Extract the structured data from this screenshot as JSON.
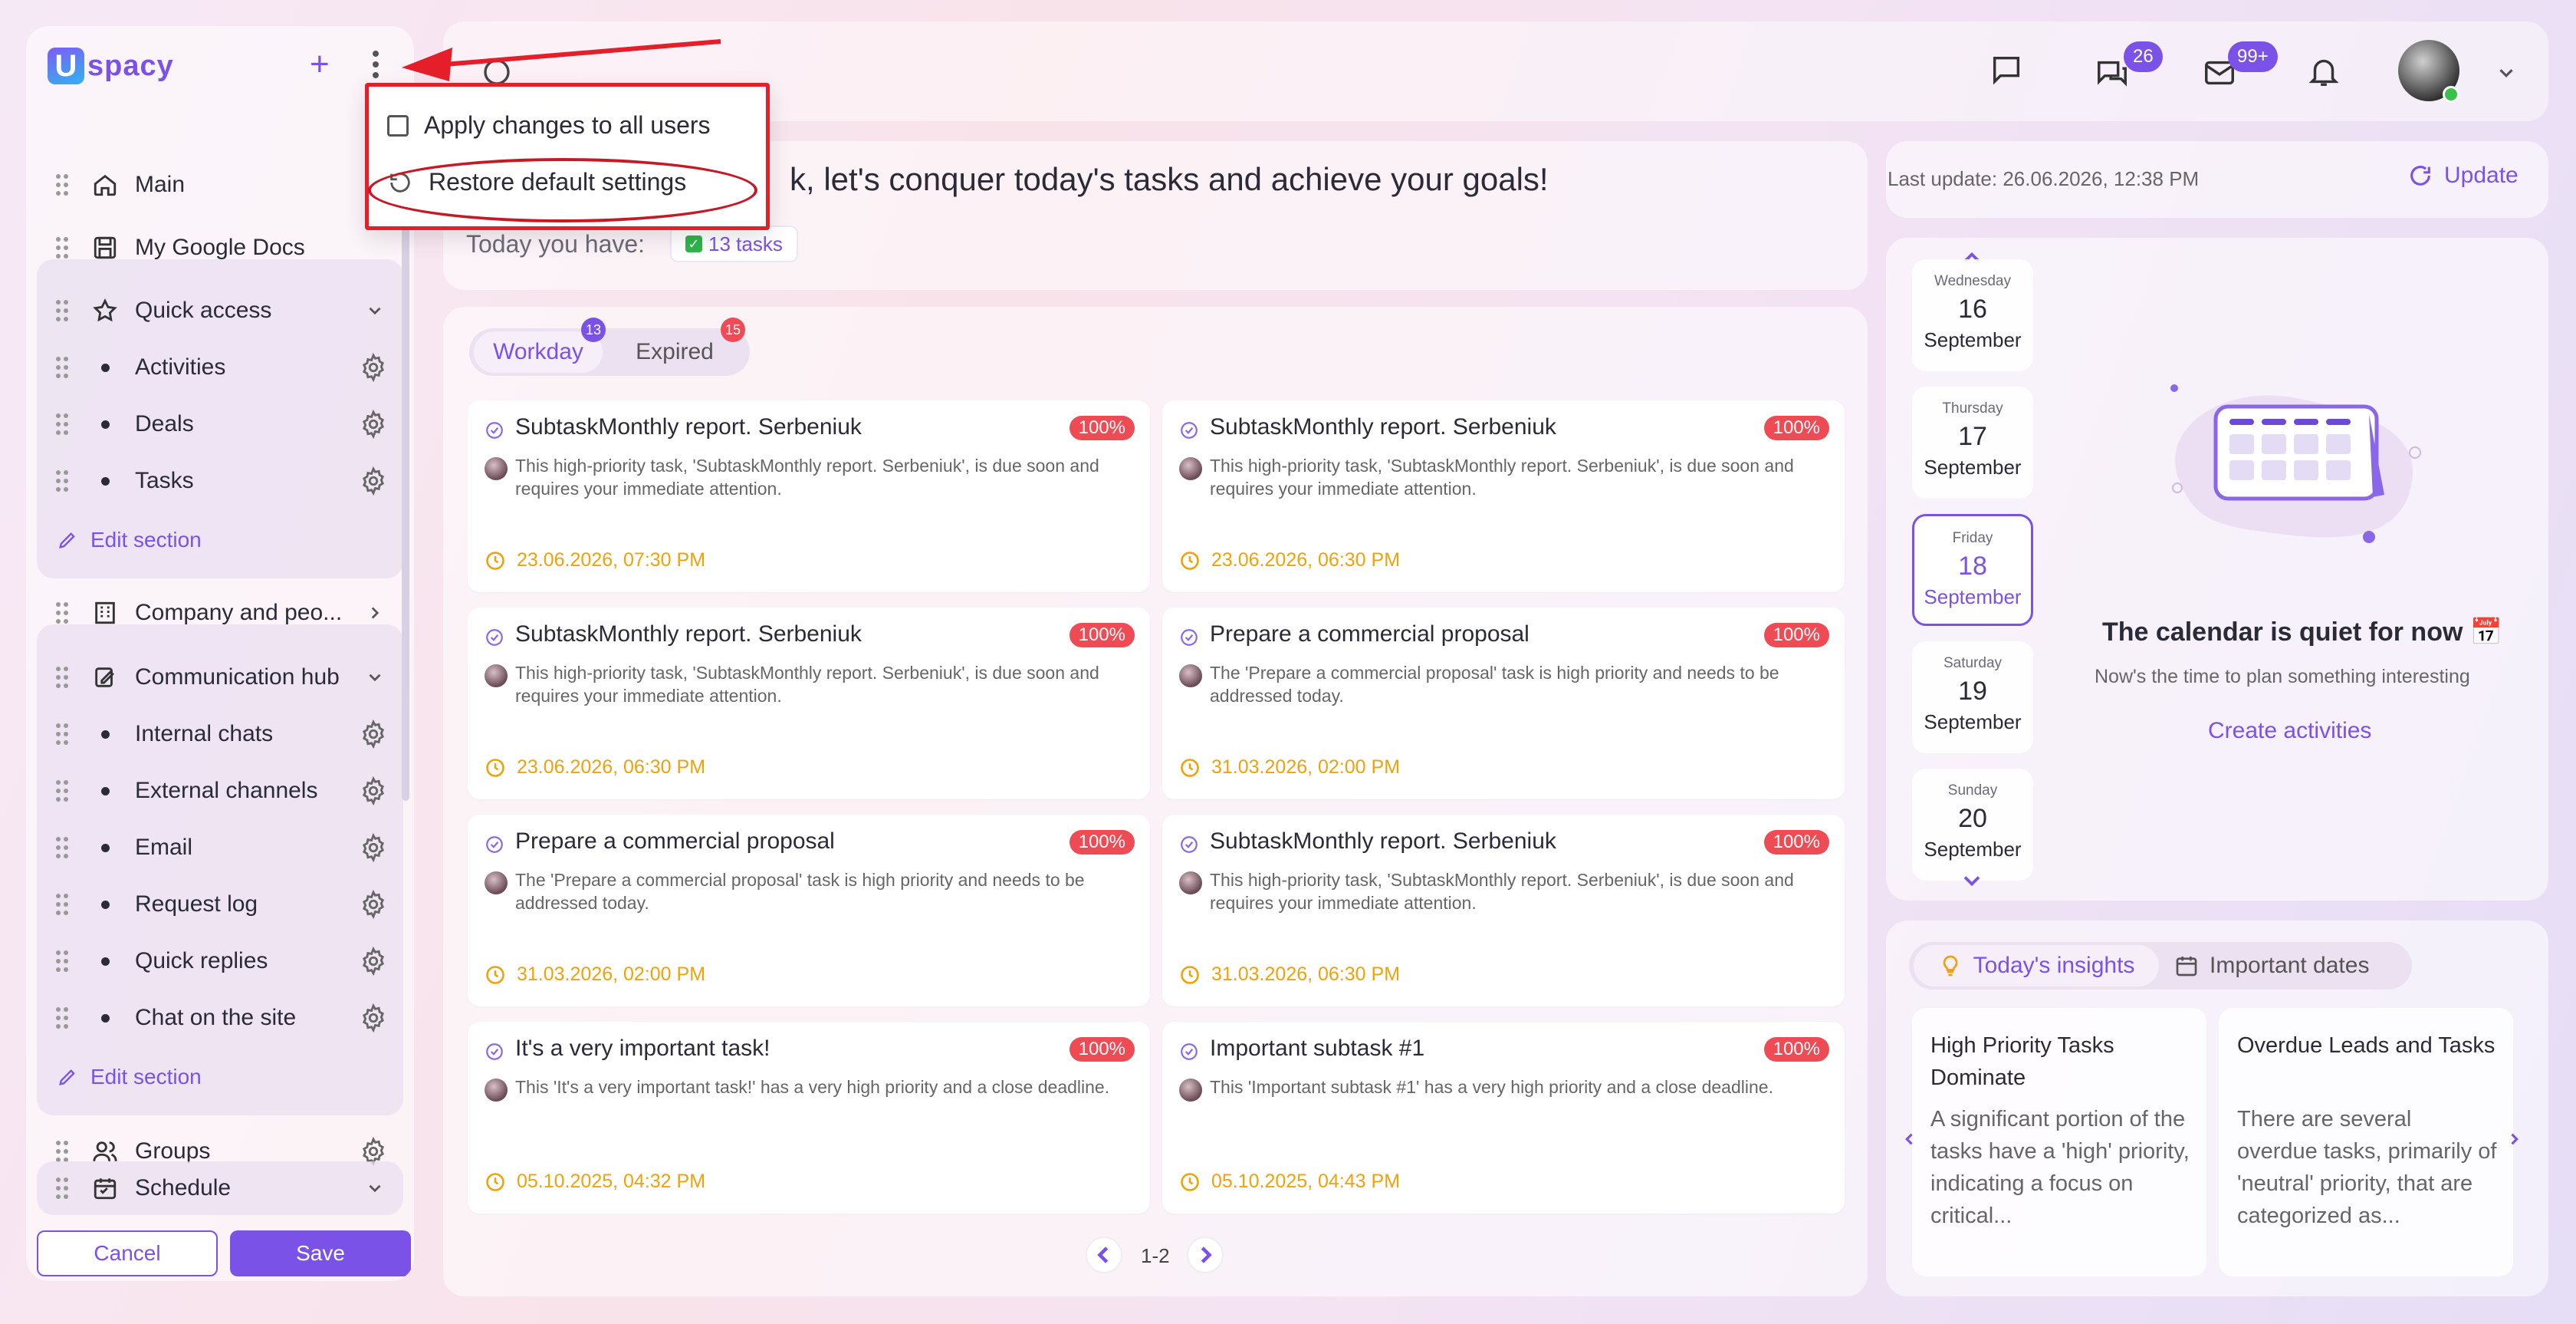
{
  "sidebar": {
    "logo_letter": "U",
    "logo_text": "spacy",
    "add_label": "+",
    "items": {
      "main": "Main",
      "google_docs": "My Google Docs",
      "quick_access": "Quick access",
      "activities": "Activities",
      "deals": "Deals",
      "tasks": "Tasks",
      "edit_section_1": "Edit section",
      "company": "Company and peo...",
      "comm_hub": "Communication hub",
      "internal_chats": "Internal chats",
      "external_channels": "External channels",
      "email": "Email",
      "request_log": "Request log",
      "quick_replies": "Quick replies",
      "chat_site": "Chat on the site",
      "edit_section_2": "Edit section",
      "groups": "Groups",
      "schedule": "Schedule"
    },
    "cancel_label": "Cancel",
    "save_label": "Save"
  },
  "popup": {
    "apply_all": "Apply changes to all users",
    "restore": "Restore default settings"
  },
  "topbar": {
    "chats_badge": "26",
    "mail_badge": "99+"
  },
  "greeting": {
    "text": "k, let's conquer today's tasks and achieve your goals!",
    "today_label": "Today you have:",
    "tasks_chip": "13 tasks",
    "chip_check": "✓"
  },
  "tabs": {
    "workday": "Workday",
    "workday_count": "13",
    "expired": "Expired",
    "expired_count": "15"
  },
  "tasks": [
    {
      "title": "SubtaskMonthly report. Serbeniuk",
      "badge": "100%",
      "desc": "This high-priority task, 'SubtaskMonthly report. Serbeniuk', is due soon and requires your immediate attention.",
      "date": "23.06.2026, 07:30 PM"
    },
    {
      "title": "SubtaskMonthly report. Serbeniuk",
      "badge": "100%",
      "desc": "This high-priority task, 'SubtaskMonthly report. Serbeniuk', is due soon and requires your immediate attention.",
      "date": "23.06.2026, 06:30 PM"
    },
    {
      "title": "SubtaskMonthly report. Serbeniuk",
      "badge": "100%",
      "desc": "This high-priority task, 'SubtaskMonthly report. Serbeniuk', is due soon and requires your immediate attention.",
      "date": "23.06.2026, 06:30 PM"
    },
    {
      "title": "Prepare a commercial proposal",
      "badge": "100%",
      "desc": "The 'Prepare a commercial proposal' task is high priority and needs to be addressed today.",
      "date": "31.03.2026, 02:00 PM"
    },
    {
      "title": "Prepare a commercial proposal",
      "badge": "100%",
      "desc": "The 'Prepare a commercial proposal' task is high priority and needs to be addressed today.",
      "date": "31.03.2026, 02:00 PM"
    },
    {
      "title": "SubtaskMonthly report. Serbeniuk",
      "badge": "100%",
      "desc": "This high-priority task, 'SubtaskMonthly report. Serbeniuk', is due soon and requires your immediate attention.",
      "date": "31.03.2026, 06:30 PM"
    },
    {
      "title": "It's a very important task!",
      "badge": "100%",
      "desc": "This 'It's a very important task!' has a very high priority and a close deadline.",
      "date": "05.10.2025, 04:32 PM"
    },
    {
      "title": "Important subtask #1",
      "badge": "100%",
      "desc": "This 'Important subtask #1' has a very high priority and a close deadline.",
      "date": "05.10.2025, 04:43 PM"
    }
  ],
  "pager": {
    "text": "1-2"
  },
  "update": {
    "last_update": "Last update: 26.06.2026, 12:38 PM",
    "label": "Update"
  },
  "calendar": {
    "days": [
      {
        "weekday": "Wednesday",
        "num": "16",
        "month": "September"
      },
      {
        "weekday": "Thursday",
        "num": "17",
        "month": "September"
      },
      {
        "weekday": "Friday",
        "num": "18",
        "month": "September"
      },
      {
        "weekday": "Saturday",
        "num": "19",
        "month": "September"
      },
      {
        "weekday": "Sunday",
        "num": "20",
        "month": "September"
      }
    ],
    "quiet_title": "The calendar is quiet for now 📅",
    "quiet_sub": "Now's the time to plan something interesting",
    "create": "Create activities"
  },
  "insights": {
    "tab_insights": "Today's insights",
    "tab_dates": "Important dates",
    "items": [
      {
        "title": "High Priority Tasks Dominate",
        "text": "A significant portion of the tasks have a 'high' priority, indicating a focus on critical..."
      },
      {
        "title": "Overdue Leads and Tasks",
        "text": "There are several overdue tasks, primarily of 'neutral' priority, that are categorized as..."
      }
    ]
  },
  "colors": {
    "accent": "#7b52e8",
    "badge_red": "#ef4b55",
    "date_orange": "#f0a20a",
    "annotation_red": "#e41f2a"
  }
}
